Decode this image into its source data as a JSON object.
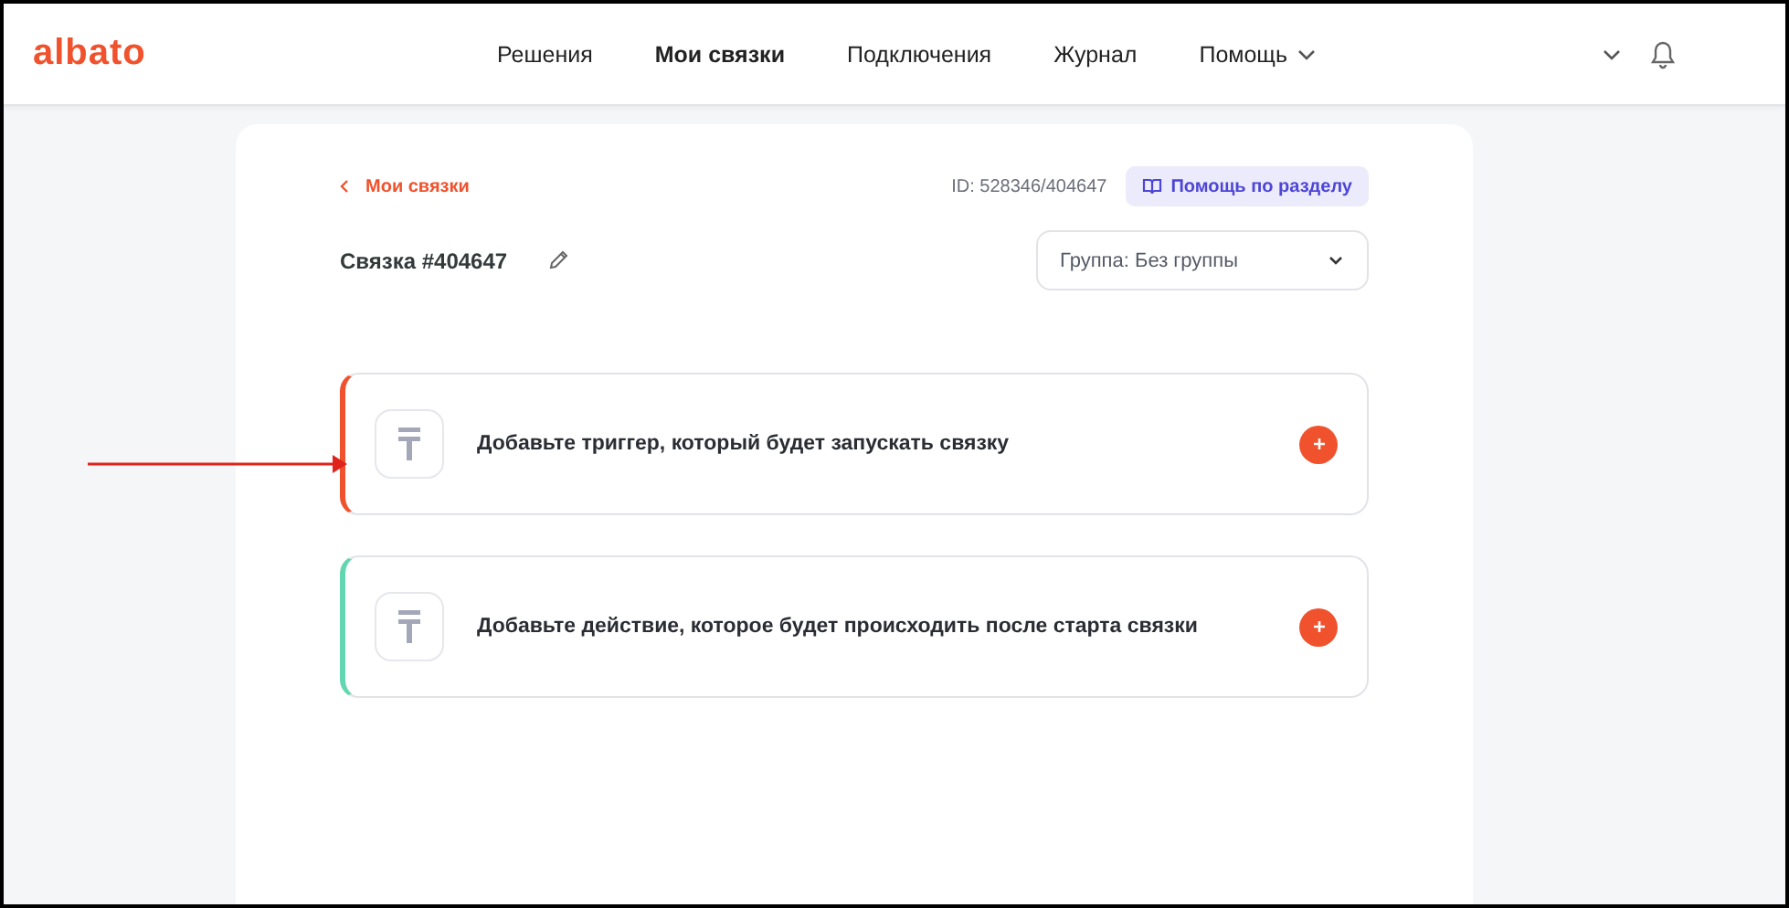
{
  "header": {
    "logo": "albato",
    "nav": [
      {
        "label": "Решения",
        "selected": false,
        "dropdown": false
      },
      {
        "label": "Мои связки",
        "selected": true,
        "dropdown": false
      },
      {
        "label": "Подключения",
        "selected": false,
        "dropdown": false
      },
      {
        "label": "Журнал",
        "selected": false,
        "dropdown": false
      },
      {
        "label": "Помощь",
        "selected": false,
        "dropdown": true
      }
    ]
  },
  "breadcrumb": {
    "back_label": "Мои связки"
  },
  "bundle_id": "ID: 528346/404647",
  "help_button": "Помощь по разделу",
  "bundle_title": "Связка #404647",
  "group_select": {
    "value": "Группа: Без группы"
  },
  "steps": [
    {
      "text": "Добавьте триггер, который будет запускать связку",
      "color": "#f0522d"
    },
    {
      "text": "Добавьте действие, которое будет происходить после старта связки",
      "color": "#62d6b0"
    }
  ]
}
